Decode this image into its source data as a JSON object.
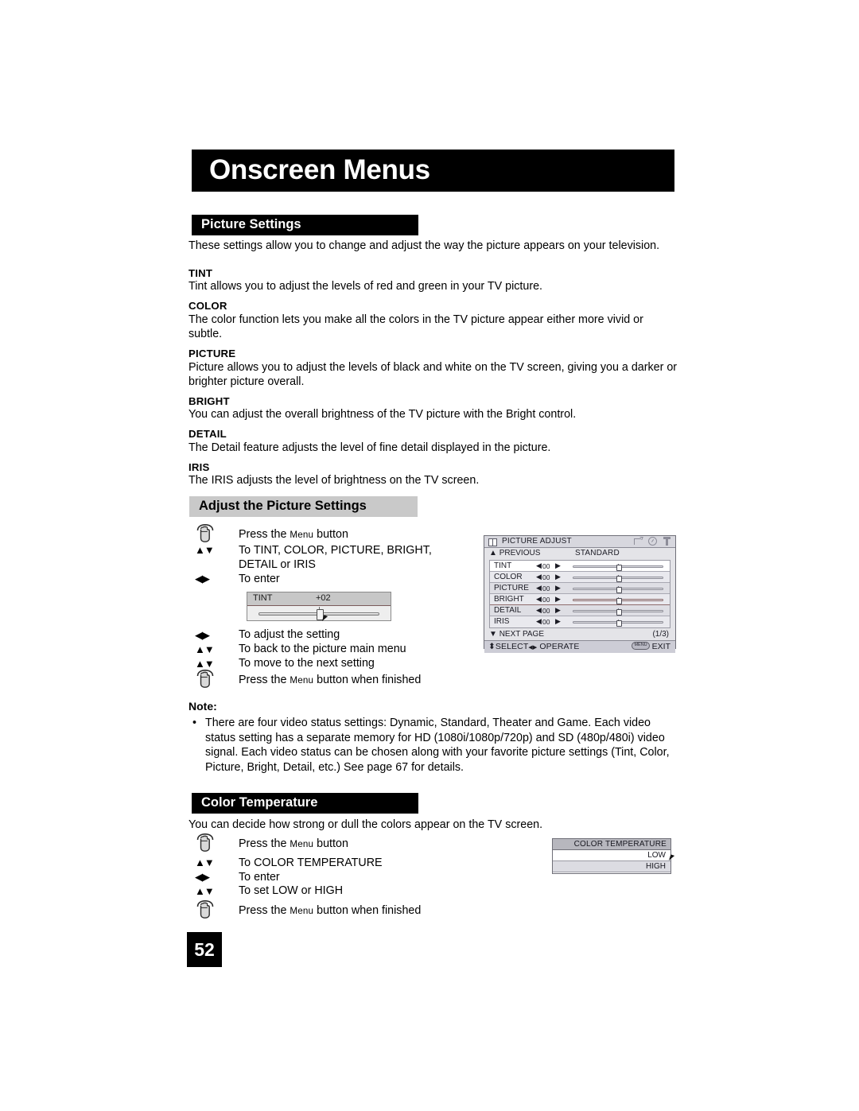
{
  "chapter": {
    "title": "Onscreen Menus"
  },
  "sections": {
    "picture_settings": {
      "heading": "Picture Settings",
      "intro": "These settings allow you to change and adjust the way the picture appears on your television.",
      "items": [
        {
          "term": "TINT",
          "desc": "Tint allows you to adjust the levels of red and green in your TV picture."
        },
        {
          "term": "COLOR",
          "desc": "The color function lets you make all the colors in the TV picture appear either more vivid or subtle."
        },
        {
          "term": "PICTURE",
          "desc": "Picture allows you to adjust the levels of black and white on the TV screen, giving you a darker or brighter picture overall."
        },
        {
          "term": "BRIGHT",
          "desc": "You can adjust the overall brightness of the TV picture with the Bright control."
        },
        {
          "term": "DETAIL",
          "desc": "The Detail feature adjusts the level of fine detail displayed in the picture."
        },
        {
          "term": "IRIS",
          "desc": "The IRIS adjusts the level of brightness on the TV screen."
        }
      ]
    },
    "adjust_picture": {
      "heading": "Adjust the Picture Settings",
      "steps_top": [
        {
          "icon": "press-hand-icon",
          "text_pre": "Press the ",
          "text_caps": "Menu",
          "text_post": " button"
        },
        {
          "icon": "up-down-arrows-icon",
          "text_line1": "To TINT, COLOR, PICTURE, BRIGHT,",
          "text_line2": "DETAIL or IRIS"
        },
        {
          "icon": "left-right-arrows-icon",
          "text": "To enter"
        }
      ],
      "steps_bottom": [
        {
          "icon": "left-right-arrows-icon",
          "text": "To adjust the setting"
        },
        {
          "icon": "up-down-arrows-icon",
          "text": "To back to the picture main menu"
        },
        {
          "icon": "up-down-arrows-icon",
          "text": "To move to the next setting"
        },
        {
          "icon": "press-hand-icon",
          "text_pre": "Press the ",
          "text_caps": "Menu",
          "text_post": " button when finished"
        }
      ],
      "tint_widget": {
        "label": "TINT",
        "value": "+02"
      }
    },
    "note": {
      "label": "Note:",
      "bullet": "There are four video status settings:  Dynamic, Standard, Theater and Game.  Each video status setting has a separate memory for HD (1080i/1080p/720p) and SD (480p/480i) video signal.  Each video status can be chosen along with your favorite picture settings (Tint, Color, Picture, Bright, Detail, etc.)  See page 67 for details."
    },
    "color_temperature": {
      "heading": "Color Temperature",
      "intro": "You can decide how strong or dull the colors appear on the TV screen.",
      "steps": [
        {
          "icon": "press-hand-icon",
          "text_pre": "Press the ",
          "text_caps": "Menu",
          "text_post": " button"
        },
        {
          "icon": "up-down-arrows-icon",
          "text": "To COLOR TEMPERATURE"
        },
        {
          "icon": "left-right-arrows-icon",
          "text": "To enter"
        },
        {
          "icon": "up-down-arrows-icon",
          "text": "To set LOW or HIGH"
        },
        {
          "icon": "press-hand-icon",
          "text_pre": "Press the ",
          "text_caps": "Menu",
          "text_post": " button when finished"
        }
      ]
    }
  },
  "osd_picture_adjust": {
    "title": "PICTURE ADJUST",
    "previous_label": "PREVIOUS",
    "mode_label": "STANDARD",
    "rows": [
      {
        "name": "TINT",
        "value": "00"
      },
      {
        "name": "COLOR",
        "value": "00"
      },
      {
        "name": "PICTURE",
        "value": "00"
      },
      {
        "name": "BRIGHT",
        "value": "00"
      },
      {
        "name": "DETAIL",
        "value": "00"
      },
      {
        "name": "IRIS",
        "value": "00"
      }
    ],
    "next_page_label": "NEXT PAGE",
    "page_indicator": "(1/3)",
    "footer_select": "SELECT",
    "footer_operate": "OPERATE",
    "footer_menu_chip": "MENU",
    "footer_exit": "EXIT"
  },
  "osd_color_temperature": {
    "title": "COLOR TEMPERATURE",
    "options": [
      "LOW",
      "HIGH"
    ]
  },
  "page_number": "52",
  "glyphs": {
    "up_down": "▲▼",
    "left_right": "◀▶",
    "up_small": "▲",
    "down_small": "▼",
    "up_down_thin": "⬍",
    "left_right_thin": "◀▶",
    "bullet": "•",
    "caret_left": "◀",
    "caret_right": "▶"
  }
}
